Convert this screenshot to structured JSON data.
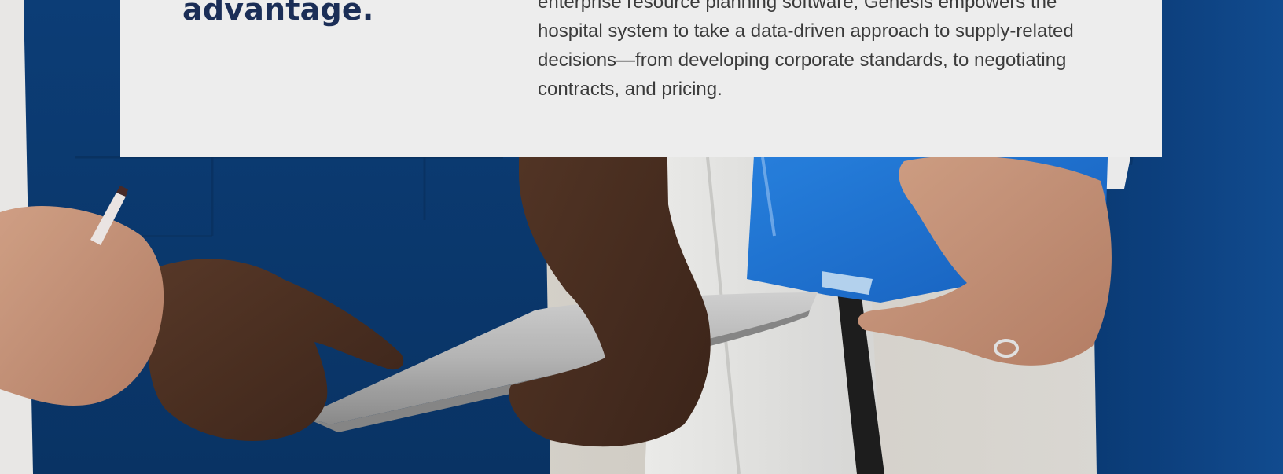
{
  "card": {
    "heading": "advantage.",
    "body": "enterprise resource planning software, Genesis empowers the hospital system to take a data-driven approach to supply-related decisions—from developing corporate standards, to negotiating contracts, and pricing."
  },
  "colors": {
    "card_background": "#ededed",
    "heading_text": "#1b2e57",
    "body_text": "#3b3b3b",
    "scrubs_blue": "#0f4a8a",
    "folder_blue": "#1c6fd1"
  }
}
